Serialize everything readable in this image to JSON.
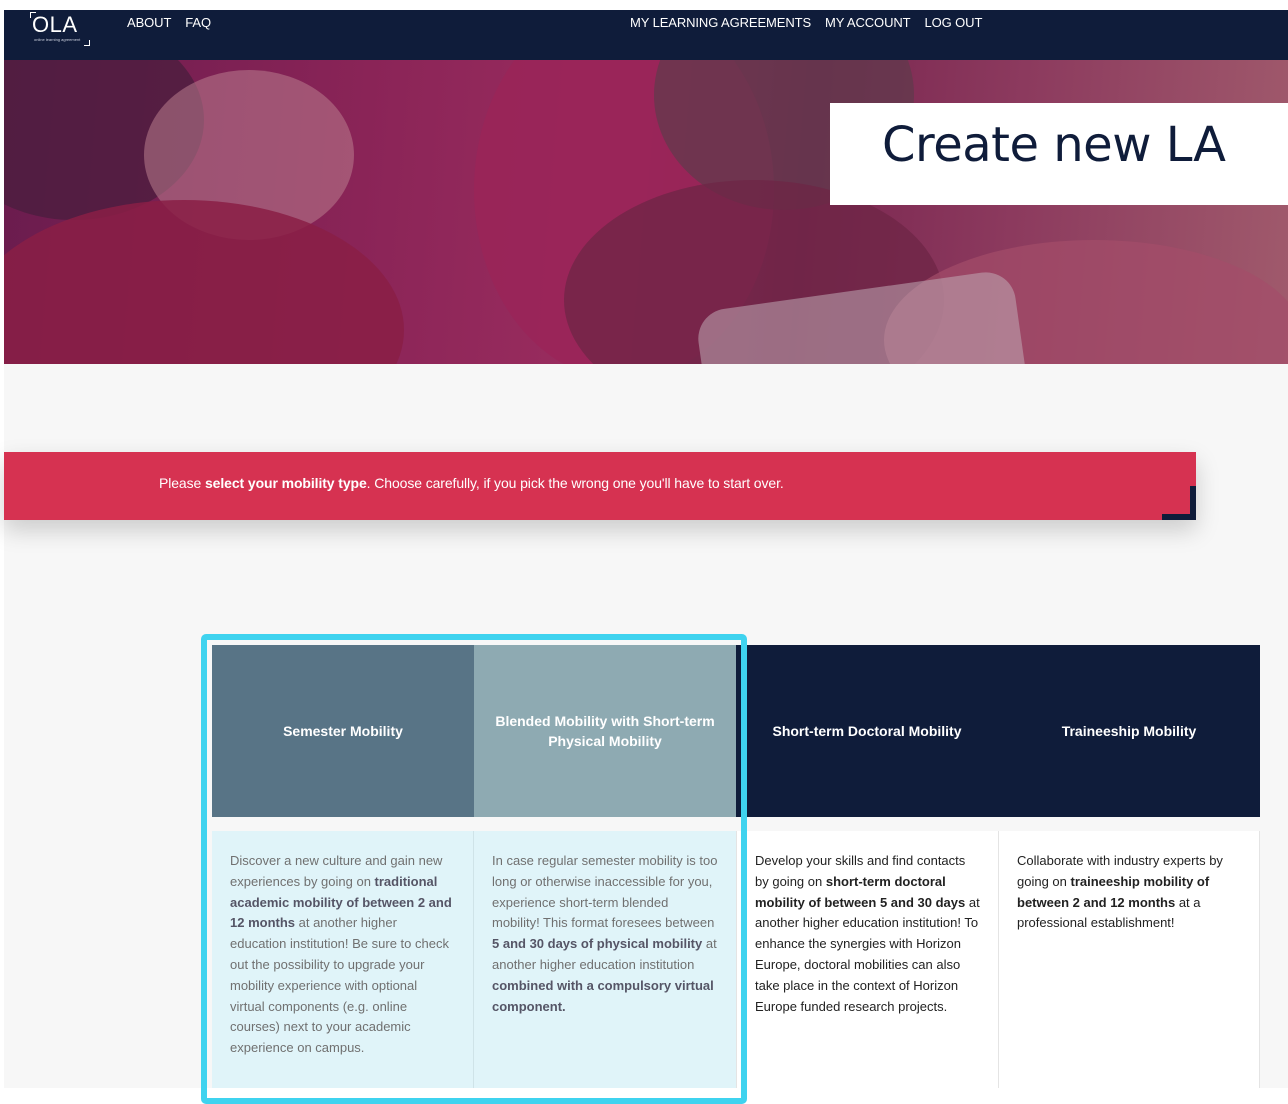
{
  "colors": {
    "navy": "#0f1c3a",
    "banner_red": "#d63251",
    "selection_cyan": "#3fd3ef",
    "semester_head": "#587486",
    "blended_head": "#8eaab2",
    "selected_body": "#e0f4f9"
  },
  "header": {
    "logo": {
      "text": "OLA",
      "tagline": "online learning agreement"
    },
    "nav_left": [
      {
        "label": "ABOUT"
      },
      {
        "label": "FAQ"
      }
    ],
    "nav_right": [
      {
        "label": "MY LEARNING AGREEMENTS"
      },
      {
        "label": "MY ACCOUNT"
      },
      {
        "label": "LOG OUT"
      }
    ]
  },
  "hero": {
    "title": "Create new LA"
  },
  "banner": {
    "prefix": "Please ",
    "emphasis": "select your mobility type",
    "suffix": ". Choose carefully, if you pick the wrong one you'll have to start over."
  },
  "mobility_types": [
    {
      "title": "Semester Mobility",
      "selected": true,
      "description": [
        {
          "t": "Discover a new culture and gain new experiences by going on "
        },
        {
          "t": "traditional academic mobility of between 2 and 12 months",
          "b": true
        },
        {
          "t": " at another higher education institution! Be sure to check out the possibility to upgrade your mobility experience with optional virtual components (e.g. online courses) next to your academic experience on campus."
        }
      ]
    },
    {
      "title": "Blended Mobility with Short-term Physical Mobility",
      "selected": true,
      "description": [
        {
          "t": "In case regular semester mobility is too long or otherwise inaccessible for you, experience short-term blended mobility! This format foresees between "
        },
        {
          "t": "5 and 30 days of physical mobility",
          "b": true
        },
        {
          "t": " at another higher education institution "
        },
        {
          "t": "combined with a compulsory virtual component.",
          "b": true
        }
      ]
    },
    {
      "title": "Short-term Doctoral Mobility",
      "selected": false,
      "description": [
        {
          "t": "Develop your skills and find contacts by going on "
        },
        {
          "t": "short-term doctoral mobility of between 5 and 30 days",
          "b": true
        },
        {
          "t": " at another higher education institution! To enhance the synergies with Horizon Europe, doctoral mobilities can also take place in the context of Horizon Europe funded research projects."
        }
      ]
    },
    {
      "title": "Traineeship Mobility",
      "selected": false,
      "description": [
        {
          "t": "Collaborate with industry experts by going on "
        },
        {
          "t": "traineeship mobility of between 2 and 12 months",
          "b": true
        },
        {
          "t": " at a professional establishment!"
        }
      ]
    }
  ]
}
